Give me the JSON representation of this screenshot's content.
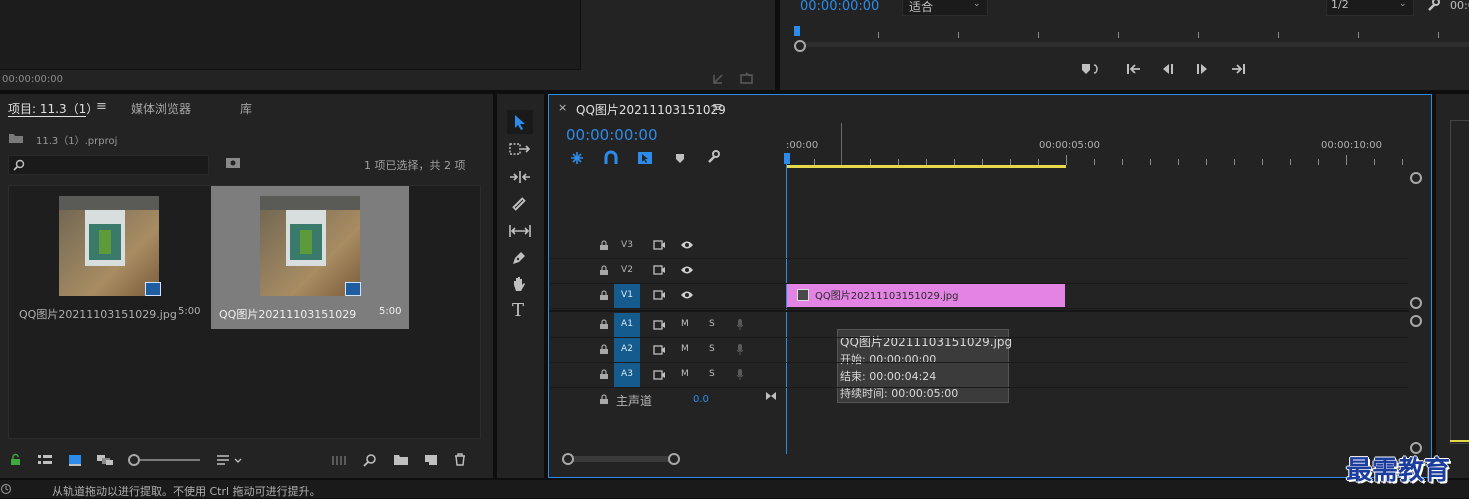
{
  "source_monitor": {
    "timecode": "00:00:00:00"
  },
  "program_monitor": {
    "timecode": "00:00:00:00",
    "fit": "适合",
    "resolution": "1/2"
  },
  "project": {
    "tabs": [
      "项目: 11.3（1）",
      "媒体浏览器",
      "库"
    ],
    "file": "11.3（1）.prproj",
    "selection": "1 项已选择，共 2 项",
    "items": [
      {
        "name": "QQ图片20211103151029.jpg",
        "duration": "5:00"
      },
      {
        "name": "QQ图片20211103151029",
        "duration": "5:00"
      }
    ]
  },
  "timeline": {
    "close": "×",
    "title": "QQ图片20211103151029",
    "timecode": "00:00:00:00",
    "ruler": [
      ":00:00",
      "00:00:05:00",
      "00:00:10:00"
    ],
    "video_tracks": [
      "V3",
      "V2",
      "V1"
    ],
    "audio_tracks": [
      "A1",
      "A2",
      "A3"
    ],
    "mute": "M",
    "solo": "S",
    "master": {
      "label": "主声道",
      "value": "0.0"
    },
    "clip": {
      "name": "QQ图片20211103151029.jpg"
    },
    "tooltip": {
      "name": "QQ图片20211103151029.jpg",
      "start": "开始: 00:00:00:00",
      "end": "结束: 00:00:04:24",
      "duration": "持续时间: 00:00:05:00"
    }
  },
  "status_bar": {
    "text": "从轨道拖动以进行提取。不使用 Ctrl 拖动可进行提升。"
  },
  "watermark": "最需教育",
  "colors": {
    "accent": "#2d8ceb",
    "clip": "#e383e3",
    "work_area": "#e5d84a",
    "track_on": "#155b8e"
  }
}
